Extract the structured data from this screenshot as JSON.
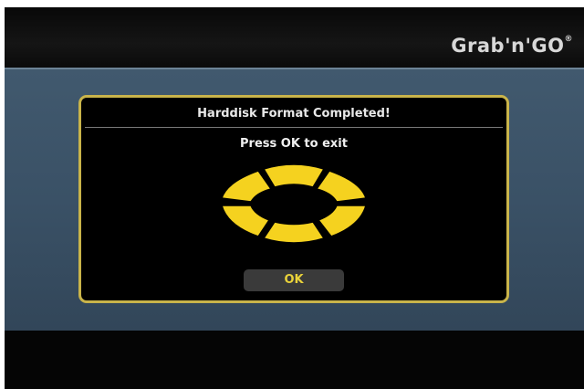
{
  "brand": {
    "logo_text": "Grab'n'GO",
    "registered_mark": "®"
  },
  "dialog": {
    "title": "Harddisk Format Completed!",
    "message": "Press OK to exit",
    "ok_label": "OK"
  },
  "colors": {
    "accent": "#c9b44a",
    "ok_text": "#e9d23a",
    "spinner_fill": "#f5d21f",
    "panel_band": "#3a5166"
  },
  "icons": {
    "spinner": "loading-spinner-icon"
  }
}
